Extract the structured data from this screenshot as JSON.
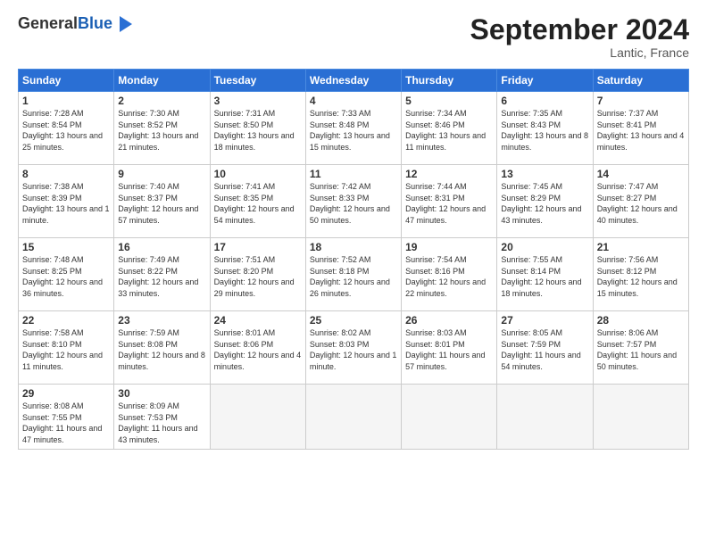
{
  "header": {
    "logo_line1": "General",
    "logo_line2": "Blue",
    "month": "September 2024",
    "location": "Lantic, France"
  },
  "days_of_week": [
    "Sunday",
    "Monday",
    "Tuesday",
    "Wednesday",
    "Thursday",
    "Friday",
    "Saturday"
  ],
  "weeks": [
    [
      {
        "day": "1",
        "sunrise": "7:28 AM",
        "sunset": "8:54 PM",
        "daylight": "13 hours and 25 minutes."
      },
      {
        "day": "2",
        "sunrise": "7:30 AM",
        "sunset": "8:52 PM",
        "daylight": "13 hours and 21 minutes."
      },
      {
        "day": "3",
        "sunrise": "7:31 AM",
        "sunset": "8:50 PM",
        "daylight": "13 hours and 18 minutes."
      },
      {
        "day": "4",
        "sunrise": "7:33 AM",
        "sunset": "8:48 PM",
        "daylight": "13 hours and 15 minutes."
      },
      {
        "day": "5",
        "sunrise": "7:34 AM",
        "sunset": "8:46 PM",
        "daylight": "13 hours and 11 minutes."
      },
      {
        "day": "6",
        "sunrise": "7:35 AM",
        "sunset": "8:43 PM",
        "daylight": "13 hours and 8 minutes."
      },
      {
        "day": "7",
        "sunrise": "7:37 AM",
        "sunset": "8:41 PM",
        "daylight": "13 hours and 4 minutes."
      }
    ],
    [
      {
        "day": "8",
        "sunrise": "7:38 AM",
        "sunset": "8:39 PM",
        "daylight": "13 hours and 1 minute."
      },
      {
        "day": "9",
        "sunrise": "7:40 AM",
        "sunset": "8:37 PM",
        "daylight": "12 hours and 57 minutes."
      },
      {
        "day": "10",
        "sunrise": "7:41 AM",
        "sunset": "8:35 PM",
        "daylight": "12 hours and 54 minutes."
      },
      {
        "day": "11",
        "sunrise": "7:42 AM",
        "sunset": "8:33 PM",
        "daylight": "12 hours and 50 minutes."
      },
      {
        "day": "12",
        "sunrise": "7:44 AM",
        "sunset": "8:31 PM",
        "daylight": "12 hours and 47 minutes."
      },
      {
        "day": "13",
        "sunrise": "7:45 AM",
        "sunset": "8:29 PM",
        "daylight": "12 hours and 43 minutes."
      },
      {
        "day": "14",
        "sunrise": "7:47 AM",
        "sunset": "8:27 PM",
        "daylight": "12 hours and 40 minutes."
      }
    ],
    [
      {
        "day": "15",
        "sunrise": "7:48 AM",
        "sunset": "8:25 PM",
        "daylight": "12 hours and 36 minutes."
      },
      {
        "day": "16",
        "sunrise": "7:49 AM",
        "sunset": "8:22 PM",
        "daylight": "12 hours and 33 minutes."
      },
      {
        "day": "17",
        "sunrise": "7:51 AM",
        "sunset": "8:20 PM",
        "daylight": "12 hours and 29 minutes."
      },
      {
        "day": "18",
        "sunrise": "7:52 AM",
        "sunset": "8:18 PM",
        "daylight": "12 hours and 26 minutes."
      },
      {
        "day": "19",
        "sunrise": "7:54 AM",
        "sunset": "8:16 PM",
        "daylight": "12 hours and 22 minutes."
      },
      {
        "day": "20",
        "sunrise": "7:55 AM",
        "sunset": "8:14 PM",
        "daylight": "12 hours and 18 minutes."
      },
      {
        "day": "21",
        "sunrise": "7:56 AM",
        "sunset": "8:12 PM",
        "daylight": "12 hours and 15 minutes."
      }
    ],
    [
      {
        "day": "22",
        "sunrise": "7:58 AM",
        "sunset": "8:10 PM",
        "daylight": "12 hours and 11 minutes."
      },
      {
        "day": "23",
        "sunrise": "7:59 AM",
        "sunset": "8:08 PM",
        "daylight": "12 hours and 8 minutes."
      },
      {
        "day": "24",
        "sunrise": "8:01 AM",
        "sunset": "8:06 PM",
        "daylight": "12 hours and 4 minutes."
      },
      {
        "day": "25",
        "sunrise": "8:02 AM",
        "sunset": "8:03 PM",
        "daylight": "12 hours and 1 minute."
      },
      {
        "day": "26",
        "sunrise": "8:03 AM",
        "sunset": "8:01 PM",
        "daylight": "11 hours and 57 minutes."
      },
      {
        "day": "27",
        "sunrise": "8:05 AM",
        "sunset": "7:59 PM",
        "daylight": "11 hours and 54 minutes."
      },
      {
        "day": "28",
        "sunrise": "8:06 AM",
        "sunset": "7:57 PM",
        "daylight": "11 hours and 50 minutes."
      }
    ],
    [
      {
        "day": "29",
        "sunrise": "8:08 AM",
        "sunset": "7:55 PM",
        "daylight": "11 hours and 47 minutes."
      },
      {
        "day": "30",
        "sunrise": "8:09 AM",
        "sunset": "7:53 PM",
        "daylight": "11 hours and 43 minutes."
      },
      null,
      null,
      null,
      null,
      null
    ]
  ]
}
